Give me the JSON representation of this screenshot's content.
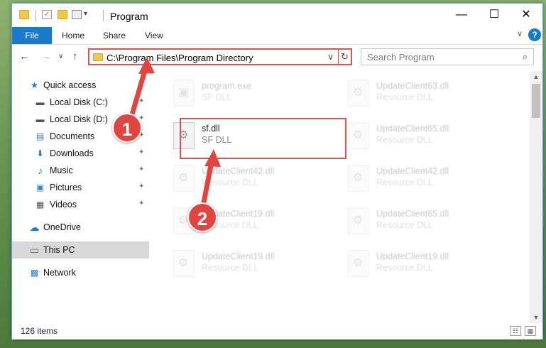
{
  "window": {
    "title": "Program",
    "minimize": "—",
    "maximize": "☐",
    "close": "✕"
  },
  "ribbon": {
    "tabs": [
      "File",
      "Home",
      "Share",
      "View"
    ],
    "expand": "∨",
    "help": "?"
  },
  "nav": {
    "back": "←",
    "forward": "→",
    "recent": "∨",
    "up": "↑",
    "address": "C:\\Program Files\\Program Directory",
    "address_dropdown": "∨",
    "refresh": "↻",
    "search_placeholder": "Search Program"
  },
  "sidebar": {
    "items": [
      {
        "label": "Quick access",
        "icon": "star-icon",
        "glyph": "★",
        "pinned": false
      },
      {
        "label": "Local Disk (C:)",
        "icon": "drive-icon",
        "glyph": "▬",
        "pinned": true
      },
      {
        "label": "Local Disk (D:)",
        "icon": "drive-icon",
        "glyph": "▬",
        "pinned": true
      },
      {
        "label": "Documents",
        "icon": "documents-icon",
        "glyph": "▤",
        "pinned": true
      },
      {
        "label": "Downloads",
        "icon": "download-icon",
        "glyph": "⬇",
        "pinned": true
      },
      {
        "label": "Music",
        "icon": "music-icon",
        "glyph": "♪",
        "pinned": true
      },
      {
        "label": "Pictures",
        "icon": "pictures-icon",
        "glyph": "▣",
        "pinned": true
      },
      {
        "label": "Videos",
        "icon": "videos-icon",
        "glyph": "▦",
        "pinned": true
      },
      {
        "label": "OneDrive",
        "icon": "cloud-icon",
        "glyph": "☁",
        "pinned": false
      },
      {
        "label": "This PC",
        "icon": "computer-icon",
        "glyph": "▭",
        "pinned": false
      },
      {
        "label": "Network",
        "icon": "network-icon",
        "glyph": "▩",
        "pinned": false
      }
    ],
    "pin_glyph": "📌"
  },
  "files": [
    {
      "name": "program.exe",
      "type": "SF DLL",
      "faded": true
    },
    {
      "name": "UpdateClient63.dll",
      "type": "Resource DLL",
      "faded": true
    },
    {
      "name": "sf.dll",
      "type": "SF DLL",
      "faded": false
    },
    {
      "name": "UpdateClient65.dll",
      "type": "Resource DLL",
      "faded": true
    },
    {
      "name": "UpdateClient42.dll",
      "type": "Resource DLL",
      "faded": true
    },
    {
      "name": "UpdateClient42.dll",
      "type": "Resource DLL",
      "faded": true
    },
    {
      "name": "UpdateClient19.dll",
      "type": "Resource DLL",
      "faded": true
    },
    {
      "name": "UpdateClient65.dll",
      "type": "Resource DLL",
      "faded": true
    },
    {
      "name": "UpdateClient19.dll",
      "type": "Resource DLL",
      "faded": true
    },
    {
      "name": "UpdateClient19.dll",
      "type": "Resource DLL",
      "faded": true
    }
  ],
  "status": {
    "item_count": "126 items",
    "details_view": "☷",
    "icons_view": "▦"
  },
  "annotations": {
    "step1": "1",
    "step2": "2",
    "color": "#e0453f"
  },
  "colors": {
    "accent": "#1979ca",
    "highlight": "#d9534f"
  }
}
